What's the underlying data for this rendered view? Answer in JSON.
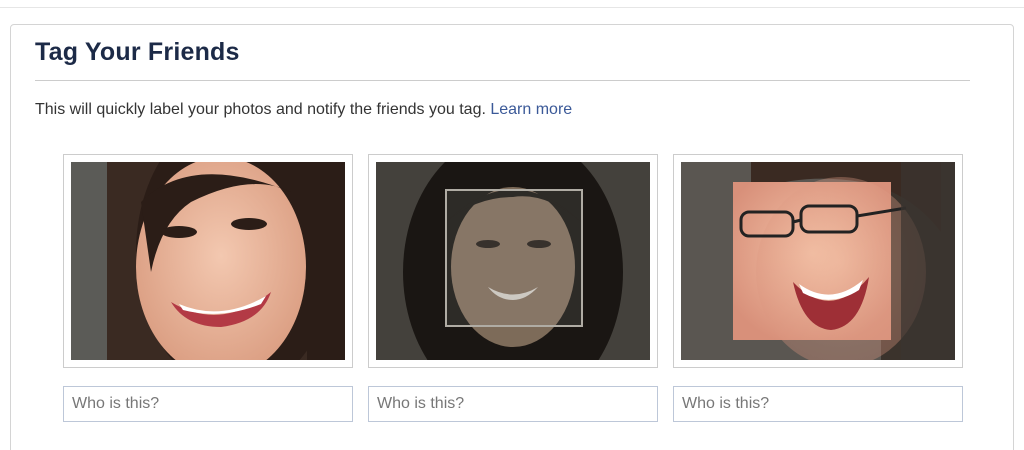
{
  "dialog": {
    "title": "Tag Your Friends",
    "description": "This will quickly label your photos and notify the friends you tag.",
    "learn_more": "Learn more"
  },
  "faces": [
    {
      "placeholder": "Who is this?",
      "value": "",
      "icon": "face-photo"
    },
    {
      "placeholder": "Who is this?",
      "value": "",
      "icon": "face-photo"
    },
    {
      "placeholder": "Who is this?",
      "value": "",
      "icon": "face-photo"
    }
  ],
  "colors": {
    "title": "#1c2a47",
    "link": "#3b5998",
    "input_border": "#bdc7d8"
  }
}
